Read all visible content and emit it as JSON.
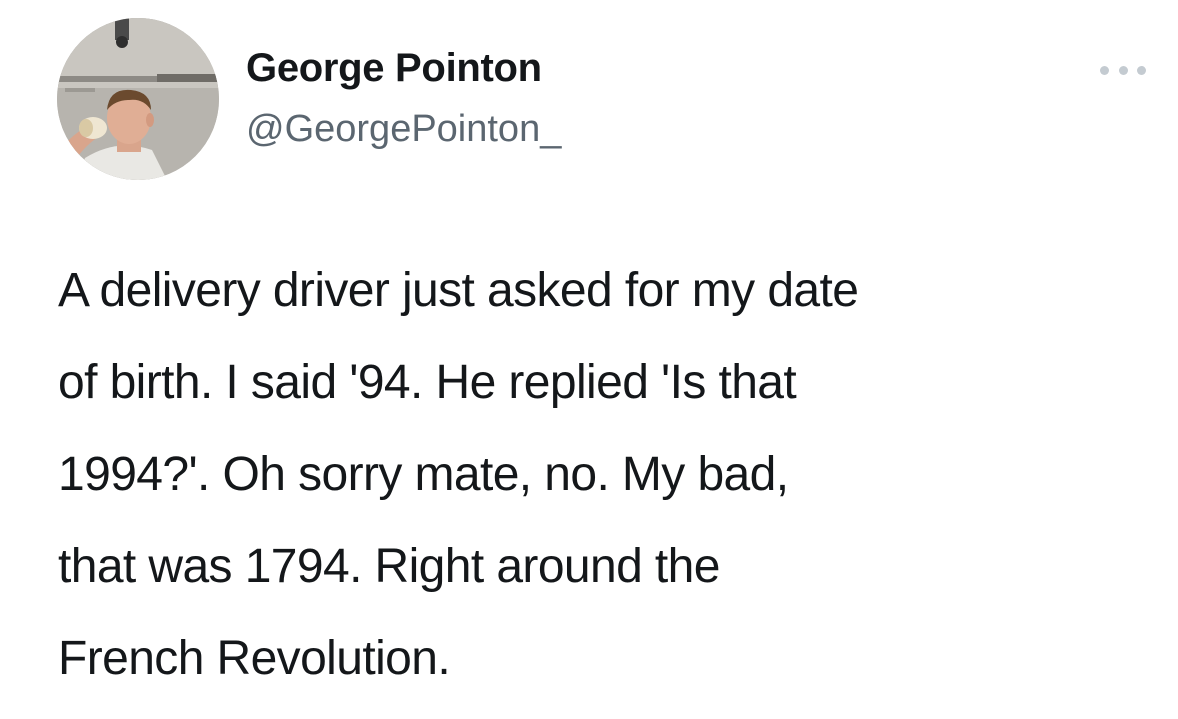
{
  "tweet": {
    "author": {
      "name": "George Pointon",
      "handle": "@GeorgePointon_"
    },
    "more_icon": "ellipsis-icon",
    "text_lines": [
      "A delivery driver just asked for my date",
      "of birth. I said '94. He replied 'Is that",
      "1994?'. Oh sorry mate, no. My bad,",
      "that was 1794. Right around the",
      "French Revolution."
    ]
  },
  "colors": {
    "text": "#14171a",
    "secondary_text": "#5b6670",
    "muted_icon": "#c4cbd1",
    "background": "#ffffff"
  }
}
